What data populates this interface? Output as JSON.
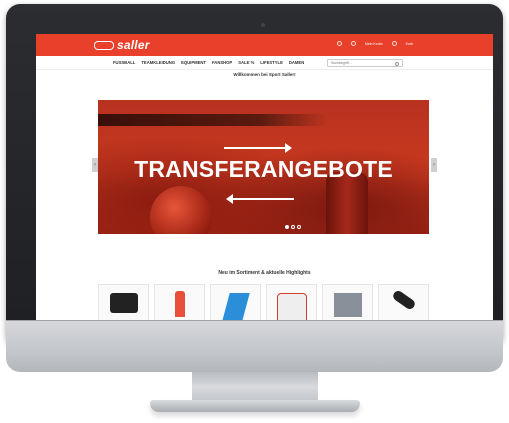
{
  "site": {
    "logo_text": "saller",
    "top_links": [
      "Merkzettel",
      "Mein Konto",
      "Korb"
    ]
  },
  "nav": {
    "items": [
      "FUSSBALL",
      "TEAMKLEIDUNG",
      "EQUIPMENT",
      "FANSHOP",
      "SALE %",
      "LIFESTYLE",
      "DAMEN"
    ],
    "search_placeholder": "Suchbegriff..."
  },
  "welcome": {
    "title": "Willkommen bei Sport Saller!"
  },
  "hero": {
    "headline": "TRANSFERANGEBOTE",
    "slides": 3,
    "active_slide": 1
  },
  "highlights": {
    "title": "Neu im Sortiment & aktuelle Highlights"
  },
  "colors": {
    "brand_red": "#e8402a",
    "bezel": "#1d1f22"
  },
  "icons": [
    "search-icon",
    "heart-icon",
    "user-icon",
    "cart-icon",
    "chevron-left-icon",
    "chevron-right-icon",
    "arrow-right-icon",
    "arrow-left-icon"
  ]
}
